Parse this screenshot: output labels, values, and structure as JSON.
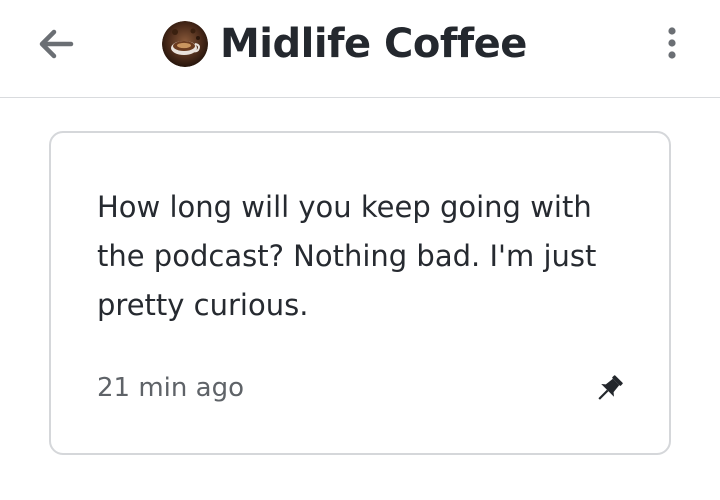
{
  "header": {
    "title": "Midlife Coffee",
    "back_icon": "arrow-left-icon",
    "menu_icon": "more-vertical-icon",
    "avatar_icon": "coffee-cup-avatar"
  },
  "card": {
    "message": "How long will you keep going with the podcast? Nothing bad. I'm just pretty curious.",
    "timestamp": "21 min ago",
    "pin_icon": "pin-icon"
  },
  "colors": {
    "text_primary": "#24282e",
    "text_secondary": "#5f6368",
    "icon_gray": "#6b6f74",
    "border": "#d5d7da"
  }
}
